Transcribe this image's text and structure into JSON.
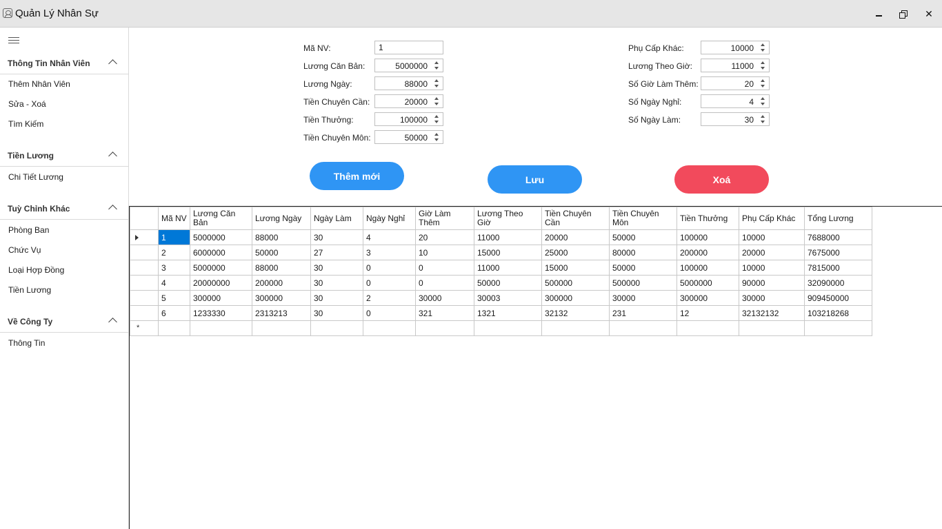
{
  "window": {
    "title": "Quản Lý Nhân Sự"
  },
  "sidebar": {
    "groups": [
      {
        "title": "Thông Tin Nhân Viên",
        "items": [
          "Thêm Nhân Viên",
          "Sửa - Xoá",
          "Tìm Kiếm"
        ]
      },
      {
        "title": "Tiền Lương",
        "items": [
          "Chi Tiết Lương"
        ]
      },
      {
        "title": "Tuỳ Chỉnh Khác",
        "items": [
          "Phòng Ban",
          "Chức Vụ",
          "Loại Hợp Đồng",
          "Tiền Lương"
        ]
      },
      {
        "title": "Về Công Ty",
        "items": [
          "Thông Tin"
        ]
      }
    ]
  },
  "form": {
    "left": [
      {
        "label": "Mã NV:",
        "value": "1"
      },
      {
        "label": "Lương Căn Bản:",
        "value": "5000000"
      },
      {
        "label": "Lương Ngày:",
        "value": "88000"
      },
      {
        "label": "Tiền Chuyên Cần:",
        "value": "20000"
      },
      {
        "label": "Tiền Thưởng:",
        "value": "100000"
      },
      {
        "label": "Tiền Chuyên Môn:",
        "value": "50000"
      }
    ],
    "right": [
      {
        "label": "Phụ Cấp Khác:",
        "value": "10000"
      },
      {
        "label": "Lương Theo Giờ:",
        "value": "11000"
      },
      {
        "label": "Số Giờ Làm Thêm:",
        "value": "20"
      },
      {
        "label": "Số Ngày Nghỉ:",
        "value": "4"
      },
      {
        "label": "Số Ngày Làm:",
        "value": "30"
      }
    ]
  },
  "buttons": {
    "add": "Thêm mới",
    "save": "Lưu",
    "delete": "Xoá"
  },
  "grid": {
    "columns": [
      "Mã NV",
      "Lương Căn Bản",
      "Lương Ngày",
      "Ngày Làm",
      "Ngày Nghỉ",
      "Giờ Làm Thêm",
      "Lương Theo Giờ",
      "Tiền Chuyên Cần",
      "Tiền Chuyên Môn",
      "Tiền Thưởng",
      "Phụ Cấp Khác",
      "Tổng Lương"
    ],
    "rows": [
      [
        "1",
        "5000000",
        "88000",
        "30",
        "4",
        "20",
        "11000",
        "20000",
        "50000",
        "100000",
        "10000",
        "7688000"
      ],
      [
        "2",
        "6000000",
        "50000",
        "27",
        "3",
        "10",
        "15000",
        "25000",
        "80000",
        "200000",
        "20000",
        "7675000"
      ],
      [
        "3",
        "5000000",
        "88000",
        "30",
        "0",
        "0",
        "11000",
        "15000",
        "50000",
        "100000",
        "10000",
        "7815000"
      ],
      [
        "4",
        "20000000",
        "200000",
        "30",
        "0",
        "0",
        "50000",
        "500000",
        "500000",
        "5000000",
        "90000",
        "32090000"
      ],
      [
        "5",
        "300000",
        "300000",
        "30",
        "2",
        "30000",
        "30003",
        "300000",
        "30000",
        "300000",
        "30000",
        "909450000"
      ],
      [
        "6",
        "1233330",
        "2313213",
        "30",
        "0",
        "321",
        "1321",
        "32132",
        "231",
        "12",
        "32132132",
        "103218268"
      ]
    ]
  }
}
